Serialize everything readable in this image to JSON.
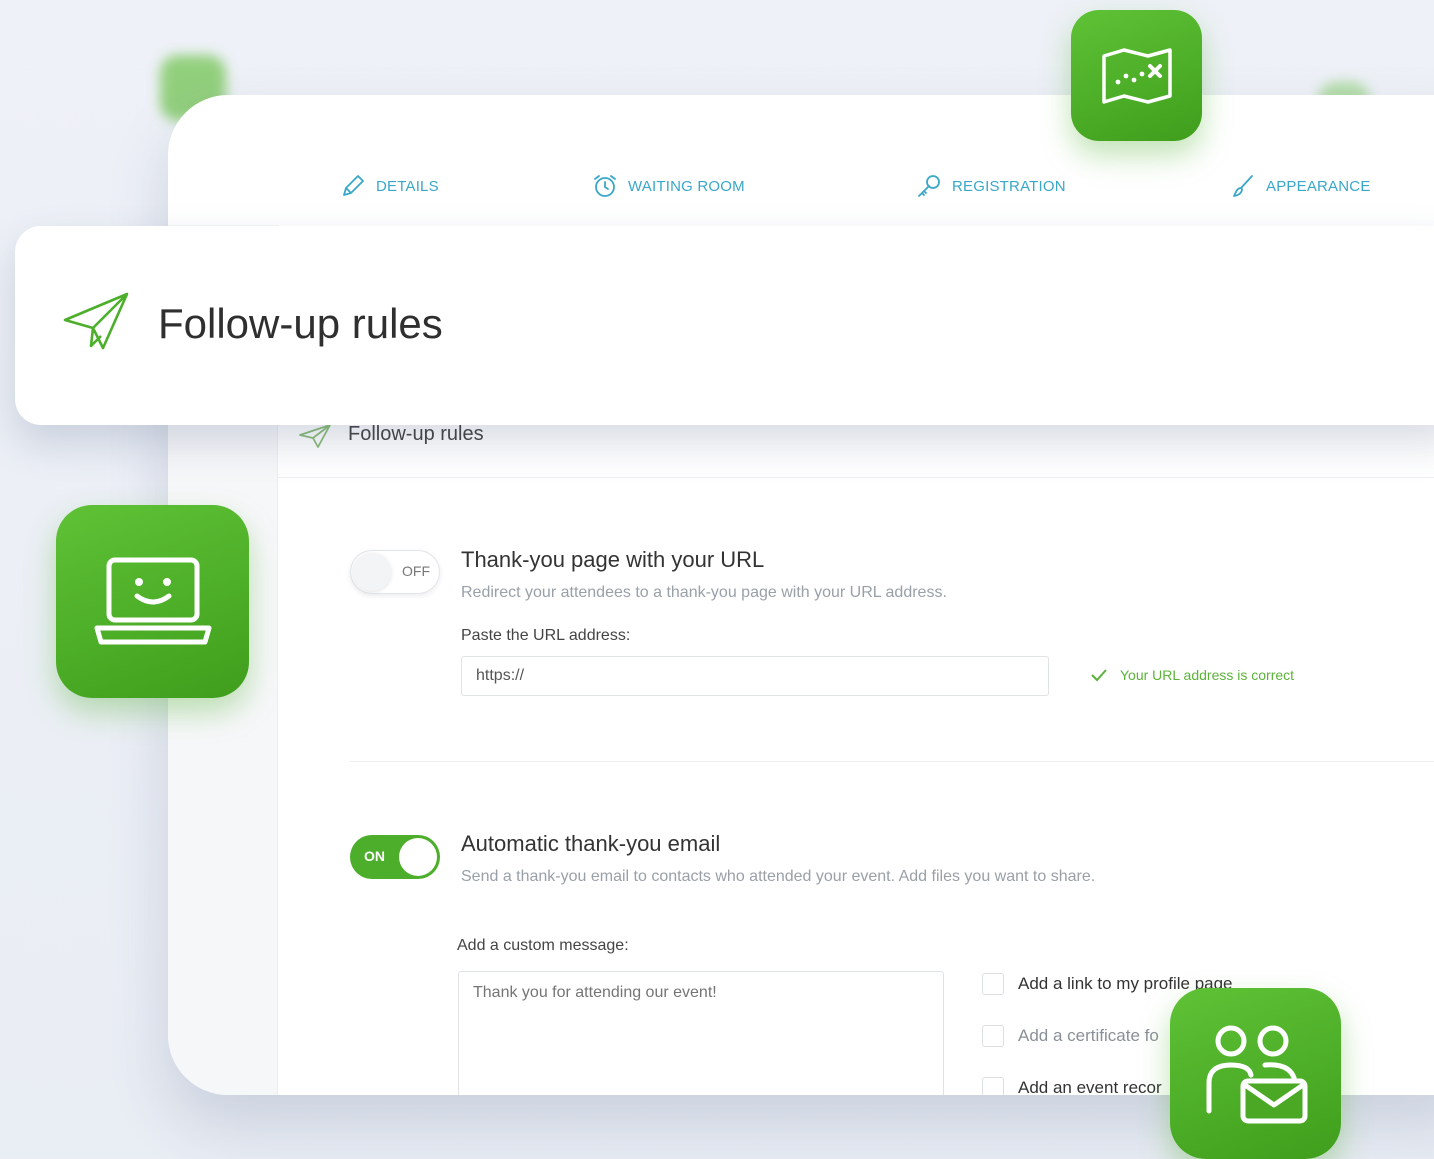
{
  "tabs": [
    {
      "label": "DETAILS",
      "icon": "pencil-icon"
    },
    {
      "label": "WAITING ROOM",
      "icon": "alarm-clock-icon"
    },
    {
      "label": "REGISTRATION",
      "icon": "key-icon"
    },
    {
      "label": "APPEARANCE",
      "icon": "brush-icon"
    }
  ],
  "float_card": {
    "title": "Follow-up rules",
    "icon": "paper-plane-icon"
  },
  "section": {
    "title": "Follow-up rules",
    "icon": "paper-plane-icon"
  },
  "thank_you_page": {
    "toggle_label": "OFF",
    "title": "Thank-you page with your URL",
    "description": "Redirect your attendees to a thank-you page with your URL address.",
    "field_label": "Paste the URL address:",
    "input_value": "https://",
    "validation": "Your URL address is correct"
  },
  "thank_you_email": {
    "toggle_label": "ON",
    "title": "Automatic thank-you email",
    "description": "Send a thank-you email to contacts who attended your event. Add files you want to share.",
    "message_label": "Add a custom message:",
    "message_placeholder": "Thank you for attending our event!",
    "options": [
      "Add a link to my profile page",
      "Add a certificate fo",
      "Add an event recor"
    ]
  },
  "colors": {
    "accent_green": "#4cae2b",
    "tab_blue": "#39a7c9"
  },
  "decor_icons": [
    "treasure-map-icon",
    "laptop-smile-icon",
    "contacts-mail-icon"
  ]
}
